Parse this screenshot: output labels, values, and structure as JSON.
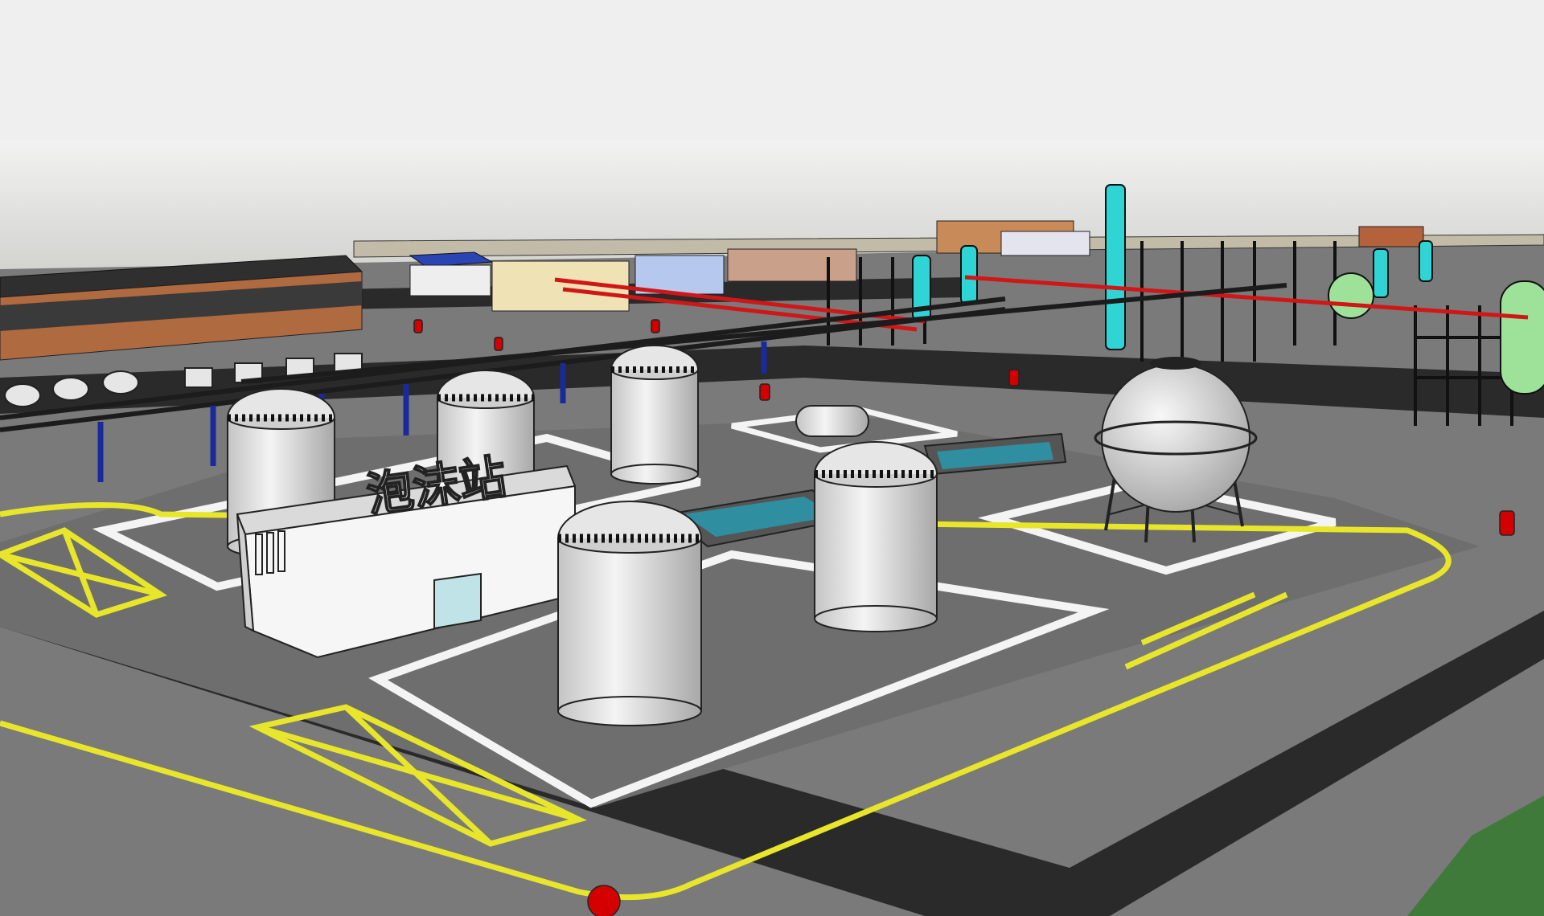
{
  "scene": {
    "sign_text": "泡沫站",
    "colors": {
      "sky_top": "#f2f2f2",
      "sky_bottom": "#d0d0cc",
      "ground": "#7a7a7a",
      "road": "#2a2a2a",
      "pad": "#6e6e6e",
      "curb": "#f4f4f4",
      "tank": "#d8d8d8",
      "marking": "#e8e62a",
      "pipe_red": "#d01616",
      "pipe_blue": "#1a2a9a",
      "column_cyan": "#2fd4d4",
      "sphere_green": "#9ee29a",
      "hydrant": "#d40000",
      "water": "#2f8fa0",
      "grass": "#3f7a3a",
      "roof_blue": "#2a44b4",
      "wall_brick": "#b06a40"
    }
  }
}
